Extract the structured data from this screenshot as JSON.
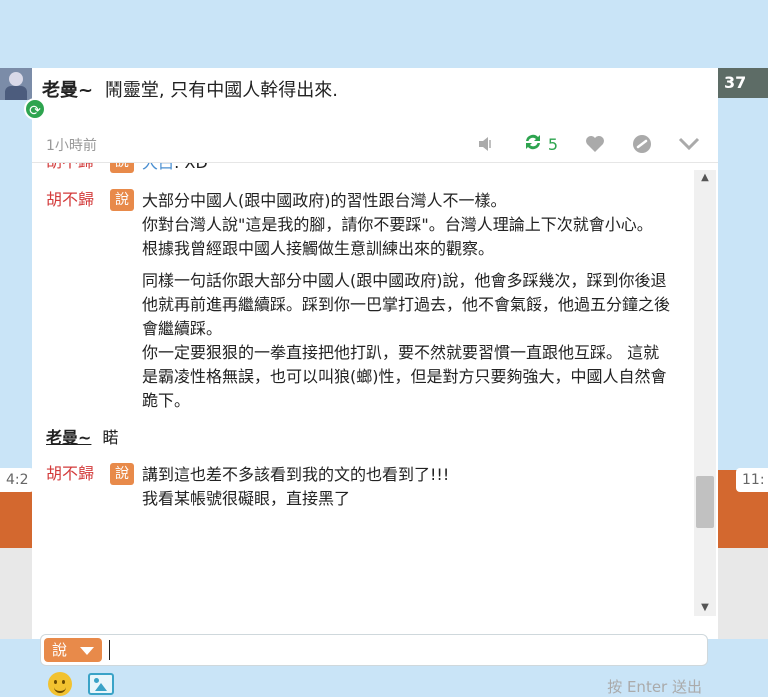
{
  "post": {
    "author": "老曼~",
    "text": "鬧靈堂, 只有中國人幹得出來.",
    "time_ago": "1小時前",
    "share_count": "5"
  },
  "side": {
    "right_count": "37",
    "left_time": "4:2",
    "right_time": "11:"
  },
  "comments": [
    {
      "author": "胡不歸",
      "say_label": "說",
      "text_prefix": "",
      "link": "大白",
      "text_suffix": ": XD"
    },
    {
      "author": "胡不歸",
      "say_label": "說",
      "paragraphs": [
        "大部分中國人(跟中國政府)的習性跟台灣人不一樣。\n你對台灣人說\"這是我的腳，請你不要踩\"。台灣人理論上下次就會小心。\n根據我曾經跟中國人接觸做生意訓練出來的觀察。",
        "同樣一句話你跟大部分中國人(跟中國政府)說，他會多踩幾次，踩到你後退他就再前進再繼續踩。踩到你一巴掌打過去，他不會氣餒，他過五分鐘之後會繼續踩。\n你一定要狠狠的一拳直接把他打趴，要不然就要習慣一直跟他互踩。 這就是霸凌性格無誤，也可以叫狼(螂)性，但是對方只要夠強大，中國人自然會跪下。"
      ]
    },
    {
      "author": "胡不歸",
      "say_label": "說",
      "paragraphs": [
        "講到這也差不多該看到我的文的也看到了!!!\n我看某帳號很礙眼，直接黑了"
      ]
    }
  ],
  "reply": {
    "user": "老曼~",
    "text": "睰"
  },
  "composer": {
    "say_label": "說",
    "send_hint": "按 Enter 送出"
  },
  "icons": {
    "sync": "sync-icon",
    "mute": "speaker-icon",
    "share": "repost-icon",
    "like": "heart-icon",
    "link": "link-icon",
    "more": "chevron-down-icon",
    "emoji": "smiley-icon",
    "image": "image-icon"
  },
  "colors": {
    "author_red": "#d33b3b",
    "say_orange": "#e88a4a",
    "share_green": "#2ea44f"
  }
}
